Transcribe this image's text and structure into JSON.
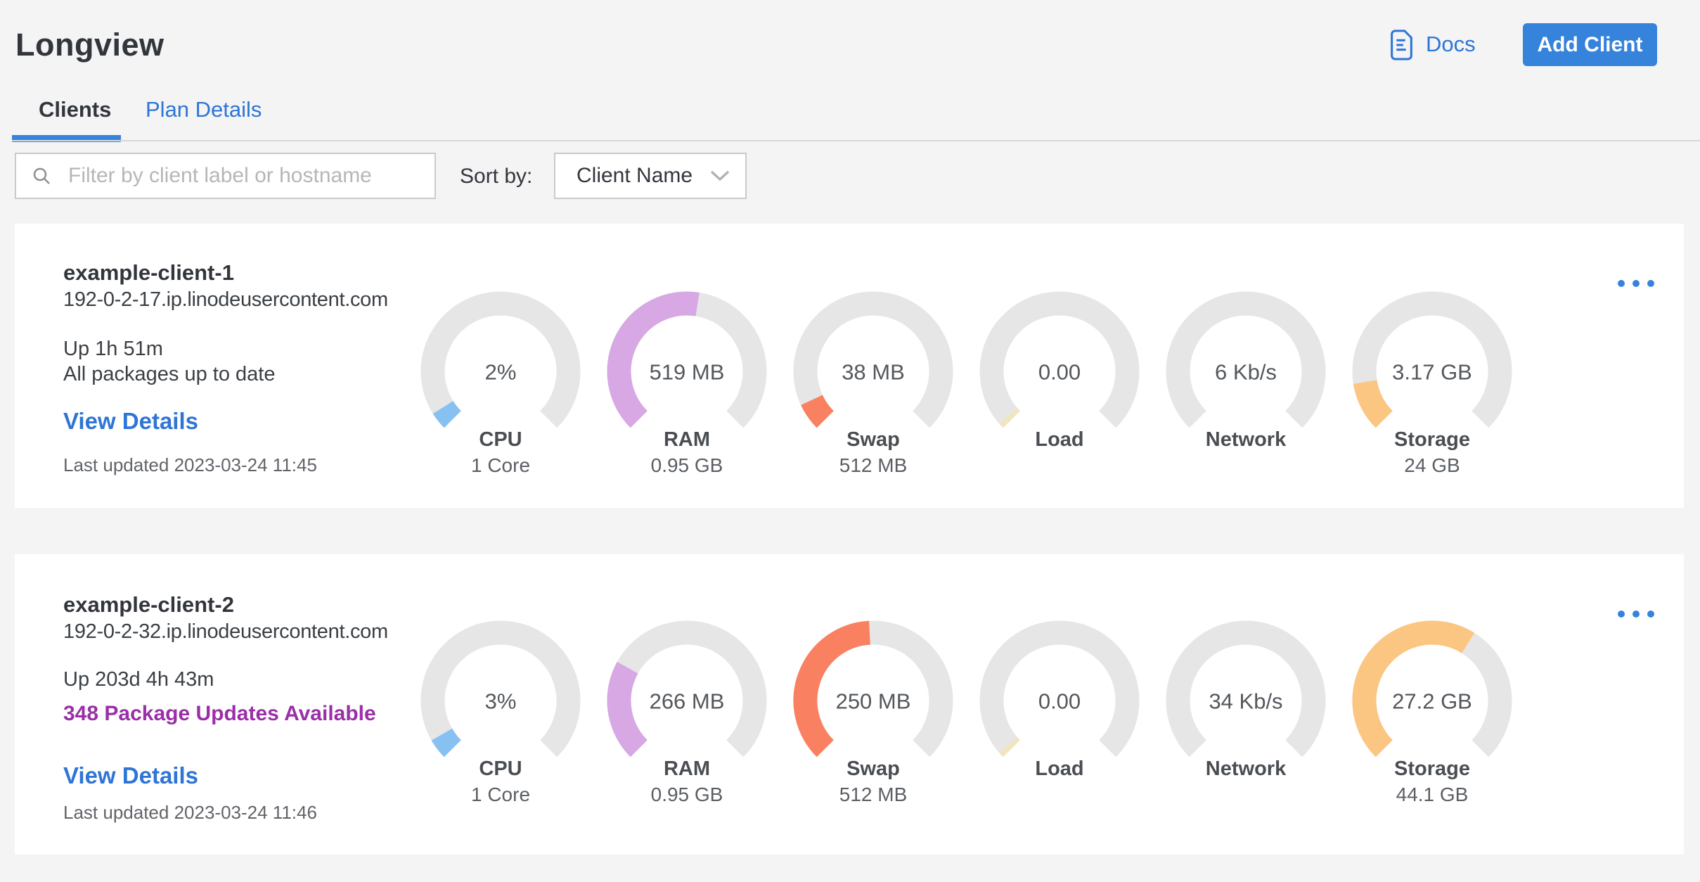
{
  "page": {
    "title": "Longview",
    "background": "#f4f4f5"
  },
  "header": {
    "docs_label": "Docs",
    "add_client_label": "Add Client"
  },
  "tabs": [
    {
      "label": "Clients",
      "active": true
    },
    {
      "label": "Plan Details",
      "active": false
    }
  ],
  "filter": {
    "placeholder": "Filter by client label or hostname",
    "value": "",
    "sort_by_label": "Sort by:",
    "sort_value": "Client Name"
  },
  "colors": {
    "accent_blue": "#3683dc",
    "link_blue": "#2e75d6",
    "purple_alert": "#9a2fa7",
    "gauge_track": "#e6e6e7"
  },
  "cards": [
    {
      "name": "example-client-1",
      "hostname": "192-0-2-17.ip.linodeusercontent.com",
      "uptime": "Up 1h 51m",
      "packages": "All packages up to date",
      "packages_highlight": false,
      "view_details_label": "View Details",
      "last_updated": "Last updated 2023-03-24 11:45",
      "gauges": [
        {
          "metric": "cpu",
          "value": "2%",
          "label": "CPU",
          "sublabel": "1 Core",
          "percent": 2,
          "arc_deg": 13,
          "color": "#87c1f1"
        },
        {
          "metric": "ram",
          "value": "519 MB",
          "label": "RAM",
          "sublabel": "0.95 GB",
          "percent": 53,
          "arc_deg": 144,
          "color": "#d7a8e3"
        },
        {
          "metric": "swap",
          "value": "38 MB",
          "label": "Swap",
          "sublabel": "512 MB",
          "percent": 7,
          "arc_deg": 20,
          "color": "#f98162"
        },
        {
          "metric": "load",
          "value": "0.00",
          "label": "Load",
          "sublabel": "",
          "percent": 1,
          "arc_deg": 4,
          "color": "#f2e4bd"
        },
        {
          "metric": "network",
          "value": "6 Kb/s",
          "label": "Network",
          "sublabel": "",
          "percent": 0,
          "arc_deg": 0,
          "color": "#b5e3a8"
        },
        {
          "metric": "storage",
          "value": "3.17 GB",
          "label": "Storage",
          "sublabel": "24 GB",
          "percent": 13,
          "arc_deg": 36,
          "color": "#fbc582"
        }
      ]
    },
    {
      "name": "example-client-2",
      "hostname": "192-0-2-32.ip.linodeusercontent.com",
      "uptime": "Up 203d 4h 43m",
      "packages": "348 Package Updates Available",
      "packages_highlight": true,
      "view_details_label": "View Details",
      "last_updated": "Last updated 2023-03-24 11:46",
      "gauges": [
        {
          "metric": "cpu",
          "value": "3%",
          "label": "CPU",
          "sublabel": "1 Core",
          "percent": 3,
          "arc_deg": 15,
          "color": "#87c1f1"
        },
        {
          "metric": "ram",
          "value": "266 MB",
          "label": "RAM",
          "sublabel": "0.95 GB",
          "percent": 27,
          "arc_deg": 74,
          "color": "#d7a8e3"
        },
        {
          "metric": "swap",
          "value": "250 MB",
          "label": "Swap",
          "sublabel": "512 MB",
          "percent": 49,
          "arc_deg": 132,
          "color": "#f98162"
        },
        {
          "metric": "load",
          "value": "0.00",
          "label": "Load",
          "sublabel": "",
          "percent": 1,
          "arc_deg": 4,
          "color": "#f2e4bd"
        },
        {
          "metric": "network",
          "value": "34 Kb/s",
          "label": "Network",
          "sublabel": "",
          "percent": 0,
          "arc_deg": 0,
          "color": "#b5e3a8"
        },
        {
          "metric": "storage",
          "value": "27.2 GB",
          "label": "Storage",
          "sublabel": "44.1 GB",
          "percent": 62,
          "arc_deg": 167,
          "color": "#fbc582"
        }
      ]
    }
  ]
}
